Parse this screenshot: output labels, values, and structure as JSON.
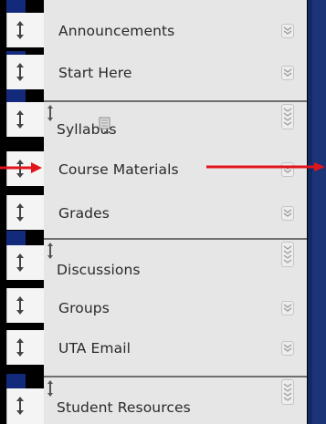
{
  "menu": {
    "items": [
      {
        "label": "Announcements"
      },
      {
        "label": "Start Here"
      },
      {
        "label": "Syllabus"
      },
      {
        "label": "Course Materials"
      },
      {
        "label": "Grades"
      },
      {
        "label": "Discussions"
      },
      {
        "label": "Groups"
      },
      {
        "label": "UTA Email"
      },
      {
        "label": "Student Resources"
      }
    ]
  },
  "icons": {
    "drag_handle": "up-down-arrow-icon",
    "expand": "chevron-double-down-icon",
    "page": "page-icon"
  },
  "colors": {
    "navy": "#13297b",
    "menu_bg": "#e6e6e6",
    "annotation_red": "#e0141b"
  }
}
